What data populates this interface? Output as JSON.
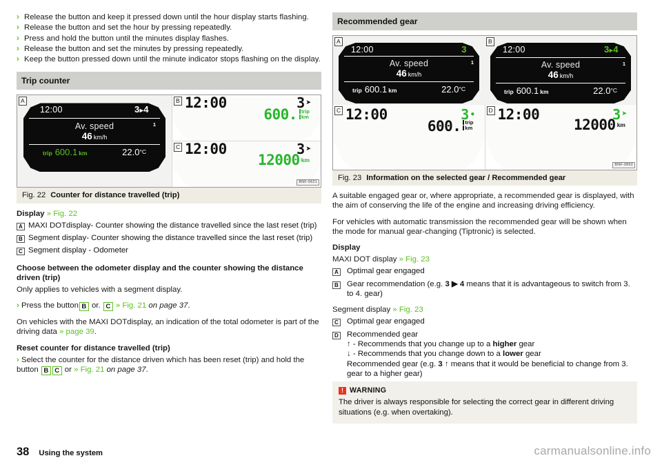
{
  "left": {
    "intro_steps": [
      "Release the button and keep it pressed down until the hour display starts flashing.",
      "Release the button and set the hour by pressing repeatedly.",
      "Press and hold the button until the minutes display flashes.",
      "Release the button and set the minutes by pressing repeatedly.",
      "Keep the button pressed down until the minute indicator stops flashing on the display."
    ],
    "section_title": "Trip counter",
    "figure": {
      "code": "BNF-0621",
      "panel_a": {
        "label": "A",
        "clock": "12:00",
        "gear": "3",
        "gear_arrow": "▸",
        "gear_to": "4",
        "title": "Av. speed",
        "value": "46",
        "unit": "km/h",
        "index": "1",
        "trip_label": "trip",
        "trip_value": "600.1",
        "trip_unit": "km",
        "temp": "22.0",
        "temp_unit": "°C"
      },
      "panel_b": {
        "label": "B",
        "clock": "12:00",
        "gear": "3",
        "value": "600.",
        "unit_line1": "trip",
        "unit_line2": "km"
      },
      "panel_c": {
        "label": "C",
        "clock": "12:00",
        "gear": "3",
        "value": "12000",
        "unit": "km"
      }
    },
    "fig_caption_no": "Fig. 22",
    "fig_caption_title": "Counter for distance travelled (trip)",
    "display_label": "Display",
    "display_ref": "» Fig. 22",
    "defs": [
      {
        "key": "A",
        "text": "MAXI DOTdisplay- Counter showing the distance travelled since the last reset (trip)"
      },
      {
        "key": "B",
        "text": "Segment display- Counter showing the distance travelled since the last reset (trip)"
      },
      {
        "key": "C",
        "text": "Segment display - Odometer"
      }
    ],
    "choose_heading": "Choose between the odometer display and the counter showing the distance driven (trip)",
    "choose_note": "Only applies to vehicles with a segment display.",
    "press_step": {
      "pre": "Press the button",
      "btn1": "B",
      "mid": "or.",
      "btn2": "C",
      "ref": "» Fig. 21",
      "page": "on page 37",
      "end": "."
    },
    "maxi_note_pre": "On vehicles with the MAXI DOTdisplay, an indication of the total odometer is part of the driving data ",
    "maxi_note_ref": "» page 39",
    "maxi_note_end": ".",
    "reset_heading": "Reset counter for distance travelled (trip)",
    "reset_step": {
      "pre": "Select the counter for the distance driven which has been reset (trip) and hold the button",
      "btn1": "B",
      "btn2": "C",
      "mid": "or",
      "ref": "» Fig. 21",
      "page": "on page 37",
      "end": "."
    }
  },
  "right": {
    "section_title": "Recommended gear",
    "figure": {
      "code": "BNF-0892",
      "panel_a": {
        "label": "A",
        "clock": "12:00",
        "gear": "3",
        "title": "Av. speed",
        "value": "46",
        "unit": "km/h",
        "index": "1",
        "trip_label": "trip",
        "trip_value": "600.1",
        "trip_unit": "km",
        "temp": "22.0",
        "temp_unit": "°C"
      },
      "panel_b": {
        "label": "B",
        "clock": "12:00",
        "gear": "3",
        "gear_arrow": "▸",
        "gear_to": "4",
        "title": "Av. speed",
        "value": "46",
        "unit": "km/h",
        "index": "1",
        "trip_label": "trip",
        "trip_value": "600.1",
        "trip_unit": "km",
        "temp": "22.0",
        "temp_unit": "°C"
      },
      "panel_c": {
        "label": "C",
        "clock": "12:00",
        "gear": "3",
        "gear_dot": "•",
        "value": "600.",
        "unit_line1": "trip",
        "unit_line2": "km"
      },
      "panel_d": {
        "label": "D",
        "clock": "12:00",
        "gear": "3",
        "gear_arrow": "⬆",
        "value": "12000",
        "unit": "km"
      }
    },
    "fig_caption_no": "Fig. 23",
    "fig_caption_title": "Information on the selected gear / Recommended gear",
    "intro_para": "A suitable engaged gear or, where appropriate, a recommended gear is displayed, with the aim of conserving the life of the engine and increasing driving efficiency.",
    "auto_para": "For vehicles with automatic transmission the recommended gear will be shown when the mode for manual gear-changing (Tiptronic) is selected.",
    "display_label": "Display",
    "maxi_line_pre": "MAXI DOT display ",
    "maxi_line_ref": "» Fig. 23",
    "maxi_defs": [
      {
        "key": "A",
        "text": "Optimal gear engaged"
      },
      {
        "key": "B",
        "pre": "Gear recommendation (e.g. ",
        "sym": "3 ▶ 4",
        "post": " means that it is advantageous to switch from 3. to 4. gear)"
      }
    ],
    "seg_line_pre": "Segment display ",
    "seg_line_ref": "» Fig. 23",
    "seg_defs": [
      {
        "key": "C",
        "text": "Optimal gear engaged"
      },
      {
        "key": "D",
        "text": "Recommended gear"
      }
    ],
    "seg_extra": {
      "up_sym": "↑",
      "up_pre": " - Recommends that you change up to a ",
      "up_bold": "higher",
      "up_post": " gear",
      "down_sym": "↓",
      "down_pre": " - Recommends that you change down to a ",
      "down_bold": "lower",
      "down_post": " gear",
      "rec_pre": "Recommended gear (e.g. ",
      "rec_sym": "3 ↑",
      "rec_post": " means that it would be beneficial to change from 3. gear to a higher gear)"
    },
    "warning": {
      "icon": "!",
      "title": "WARNING",
      "body": "The driver is always responsible for selecting the correct gear in different driving situations (e.g. when overtaking)."
    }
  },
  "footer": {
    "page_number": "38",
    "chapter": "Using the system",
    "watermark": "carmanualsonline.info"
  },
  "colors": {
    "accent_green": "#5bbf21",
    "lcd_green": "#29b62c",
    "section_bar": "#cfd0cb",
    "caption_bar": "#eeece3",
    "warning_red": "#e8341c"
  }
}
